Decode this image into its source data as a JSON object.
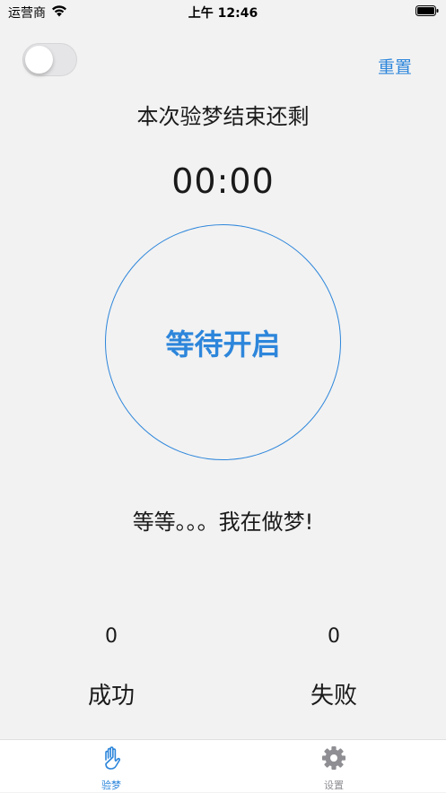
{
  "status_bar": {
    "carrier": "运营商",
    "time": "上午 12:46"
  },
  "header": {
    "toggle_on": false,
    "reset_label": "重置"
  },
  "main": {
    "subtitle": "本次验梦结束还剩",
    "timer": "00:00",
    "start_button_label": "等待开启",
    "dream_message": "等等。。。我在做梦!"
  },
  "stats": {
    "success_count": "0",
    "success_label": "成功",
    "fail_count": "0",
    "fail_label": "失败"
  },
  "tab_bar": {
    "tabs": [
      {
        "label": "验梦",
        "icon": "hand-icon",
        "active": true
      },
      {
        "label": "设置",
        "icon": "gear-icon",
        "active": false
      }
    ]
  },
  "colors": {
    "accent": "#2d86db",
    "background": "#f2f2f2",
    "inactive": "#8e8e93"
  }
}
